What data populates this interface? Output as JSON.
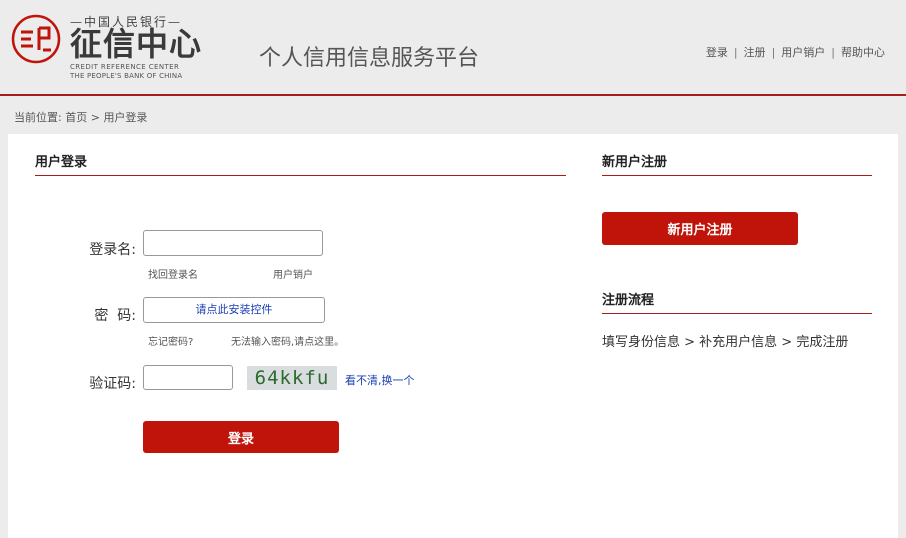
{
  "header": {
    "logo_top": "—中国人民银行—",
    "logo_main": "征信中心",
    "logo_en_line1": "CREDIT REFERENCE CENTER",
    "logo_en_line2": "THE PEOPLE'S BANK OF CHINA",
    "platform_title": "个人信用信息服务平台",
    "links": [
      "登录",
      "注册",
      "用户销户",
      "帮助中心"
    ],
    "link_separator": "|"
  },
  "breadcrumb": {
    "prefix": "当前位置:",
    "home": "首页",
    "separator": ">",
    "current": "用户登录"
  },
  "login": {
    "section_title": "用户登录",
    "username_label": "登录名:",
    "username_value": "",
    "find_login_name": "找回登录名",
    "cancel_account": "用户销户",
    "password_label": "密  码:",
    "password_control_text": "请点此安装控件",
    "forgot_password": "忘记密码?",
    "cannot_input_password": "无法输入密码,请点这里。",
    "captcha_label": "验证码:",
    "captcha_value": "",
    "captcha_text": "64kkfu",
    "captcha_refresh": "看不清,换一个",
    "submit_label": "登录"
  },
  "register": {
    "section_title": "新用户注册",
    "button_label": "新用户注册",
    "flow_title": "注册流程",
    "flow_steps": "填写身份信息 > 补充用户信息 > 完成注册"
  },
  "colors": {
    "brand_red": "#c0140a",
    "rule_red": "#a61b1b",
    "link_blue": "#1a3fb5"
  }
}
